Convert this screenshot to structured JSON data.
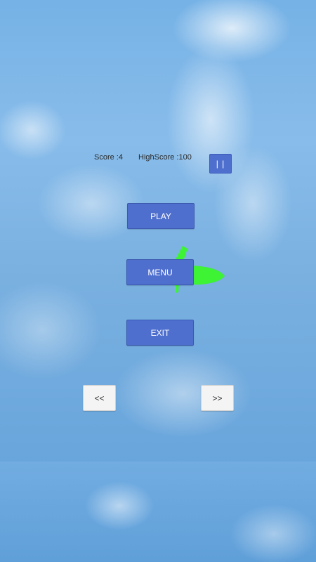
{
  "hud": {
    "score_text": "Score :4",
    "highscore_text": "HighScore :100",
    "pause_label": "| |"
  },
  "menu": {
    "play_label": "PLAY",
    "menu_label": "MENU",
    "exit_label": "EXIT"
  },
  "nav": {
    "prev_label": "<<",
    "next_label": ">>"
  },
  "player": {
    "icon": "plane-icon",
    "color": "#3ef234"
  },
  "colors": {
    "button_blue": "#4f6fcf",
    "nav_button": "#f4f4f4",
    "sky": "#76b2e6"
  }
}
